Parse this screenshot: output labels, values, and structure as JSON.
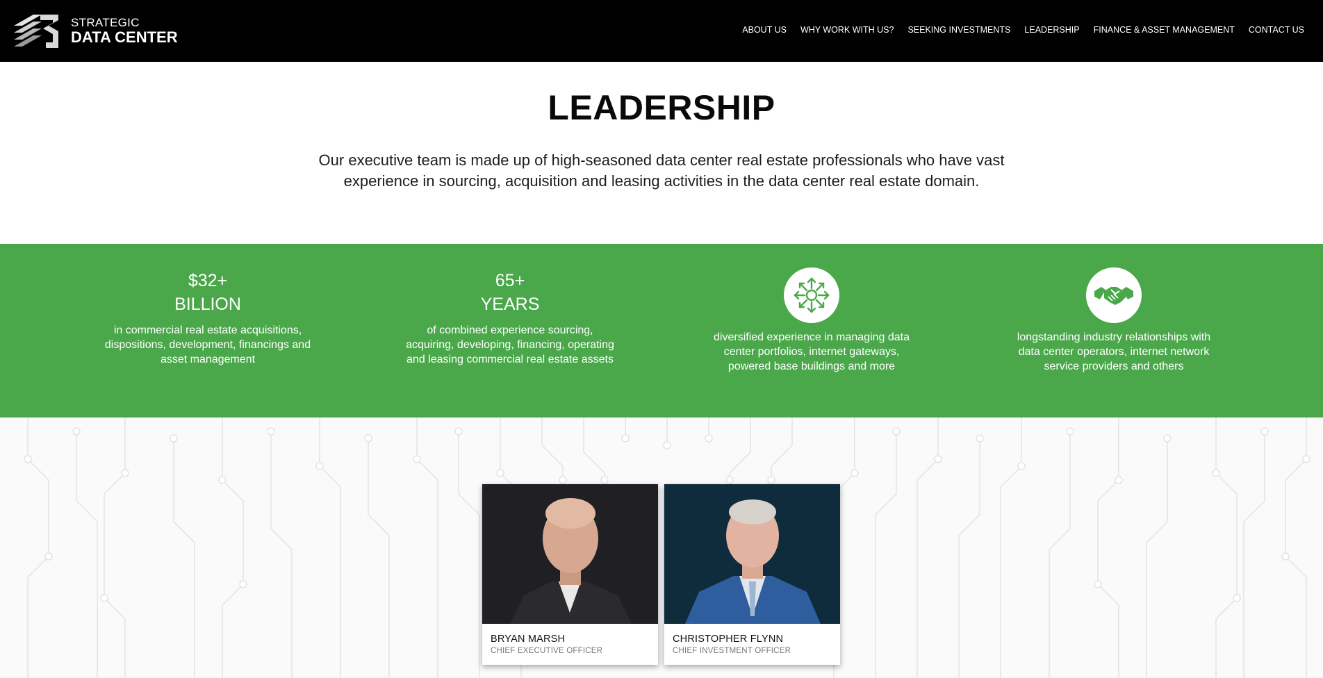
{
  "brand": {
    "line1": "STRATEGIC",
    "line2": "DATA CENTER"
  },
  "nav": [
    {
      "label": "ABOUT US"
    },
    {
      "label": "WHY WORK WITH US?"
    },
    {
      "label": "SEEKING INVESTMENTS"
    },
    {
      "label": "LEADERSHIP"
    },
    {
      "label": "FINANCE & ASSET MANAGEMENT"
    },
    {
      "label": "CONTACT US"
    }
  ],
  "page": {
    "title": "LEADERSHIP",
    "intro": "Our executive team is made up of high-seasoned data center real estate professionals who have vast experience in sourcing, acquisition and leasing activities in the data center real estate domain."
  },
  "stats": [
    {
      "number": "$32+",
      "unit": "BILLION",
      "desc": "in commercial real estate acquisitions, dispositions, development, financings and asset management"
    },
    {
      "number": "65+",
      "unit": "YEARS",
      "desc": "of combined experience sourcing, acquiring, developing, financing, operating and leasing commercial real estate assets"
    },
    {
      "icon": "network-arrows-icon",
      "desc": "diversified experience in managing data center portfolios, internet gateways, powered base buildings and more"
    },
    {
      "icon": "handshake-icon",
      "desc": "longstanding industry relationships with data center operators, internet network service providers and others"
    }
  ],
  "team": [
    {
      "name": "BRYAN MARSH",
      "role": "CHIEF EXECUTIVE OFFICER"
    },
    {
      "name": "CHRISTOPHER FLYNN",
      "role": "CHIEF INVESTMENT OFFICER"
    }
  ],
  "colors": {
    "header_bg": "#000000",
    "band_bg": "#4aa84a",
    "text_dark": "#111111"
  }
}
